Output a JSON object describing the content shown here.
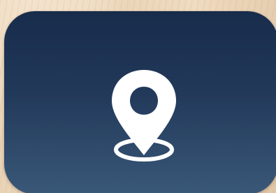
{
  "tile": {
    "icon": "location-pin-icon",
    "gradient_top": "#182c4b",
    "gradient_bottom": "#3a5878",
    "glyph_color": "#ffffff"
  },
  "background": {
    "texture": "light wood",
    "base_color": "#ecd6b9"
  }
}
